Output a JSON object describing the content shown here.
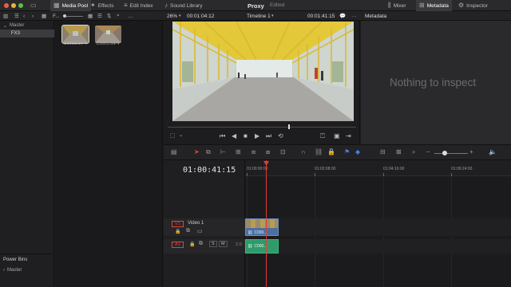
{
  "topbar": {
    "media_pool": "Media Pool",
    "effects": "Effects",
    "edit_index": "Edit Index",
    "sound_library": "Sound Library",
    "project_title": "Proxy",
    "project_status": "Edited",
    "mixer": "Mixer",
    "metadata": "Metadata",
    "inspector": "Inspector"
  },
  "subbar": {
    "zoom": "26%",
    "source_timecode": "00:01:04:12",
    "timeline_name": "Timeline 1",
    "timeline_timecode": "00:01:41:15",
    "metadata_header": "Metadata",
    "pool_path": "F..."
  },
  "bins": {
    "master": "Master",
    "fx3": "FX3",
    "power_bins": "Power Bins",
    "power_master": "Master"
  },
  "clips": [
    {
      "name": "C0003.MP4"
    },
    {
      "name": "C0005.MP4"
    }
  ],
  "metadata_panel": {
    "empty_text": "Nothing to inspect"
  },
  "timeline": {
    "timecode": "01:00:41:15",
    "ruler": [
      "01:00:00:00",
      "01:02:08:00",
      "01:04:16:00",
      "01:06:24:00"
    ],
    "video_track": {
      "id": "V1",
      "name": "Video 1",
      "clip": "C000..."
    },
    "audio_track": {
      "id": "A1",
      "level": "2.0",
      "clip": "C000..."
    },
    "solo": "S",
    "mute": "M"
  },
  "colors": {
    "accent_red": "#e0443a",
    "video_clip": "#4a6fa0",
    "audio_clip": "#2f9a6a",
    "playhead": "#e33b35"
  }
}
